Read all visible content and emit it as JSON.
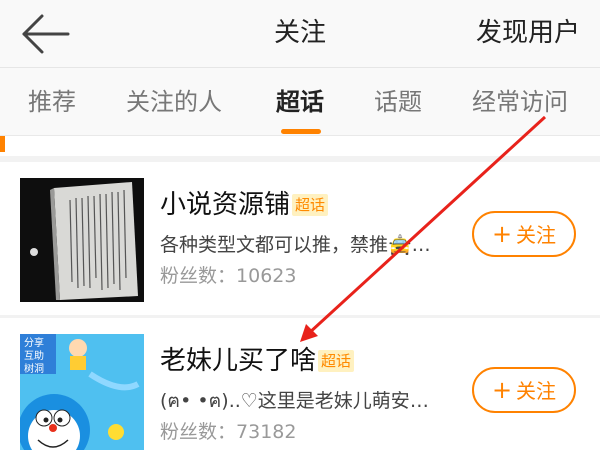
{
  "header": {
    "title": "关注",
    "discover_label": "发现用户"
  },
  "tabs": [
    {
      "label": "推荐"
    },
    {
      "label": "关注的人"
    },
    {
      "label": "超话"
    },
    {
      "label": "话题"
    },
    {
      "label": "经常访问"
    }
  ],
  "active_tab": "超话",
  "items": [
    {
      "title": "小说资源铺",
      "badge": "超话",
      "description": "各种类型文都可以推，禁推🚖…",
      "fans_label": "粉丝数：",
      "fans_count": "10623",
      "follow_label": "关注"
    },
    {
      "title": "老妹儿买了啥",
      "badge": "超话",
      "description": "(ฅ• •ฅ)..♡这里是老妹儿萌安利…",
      "fans_label": "粉丝数：",
      "fans_count": "73182",
      "follow_label": "关注"
    }
  ],
  "thumbnail_text": {
    "line1": "分享",
    "line2": "互助",
    "line3": "树洞"
  },
  "colors": {
    "accent": "#ff8200",
    "annotation_arrow": "#e8221b"
  }
}
